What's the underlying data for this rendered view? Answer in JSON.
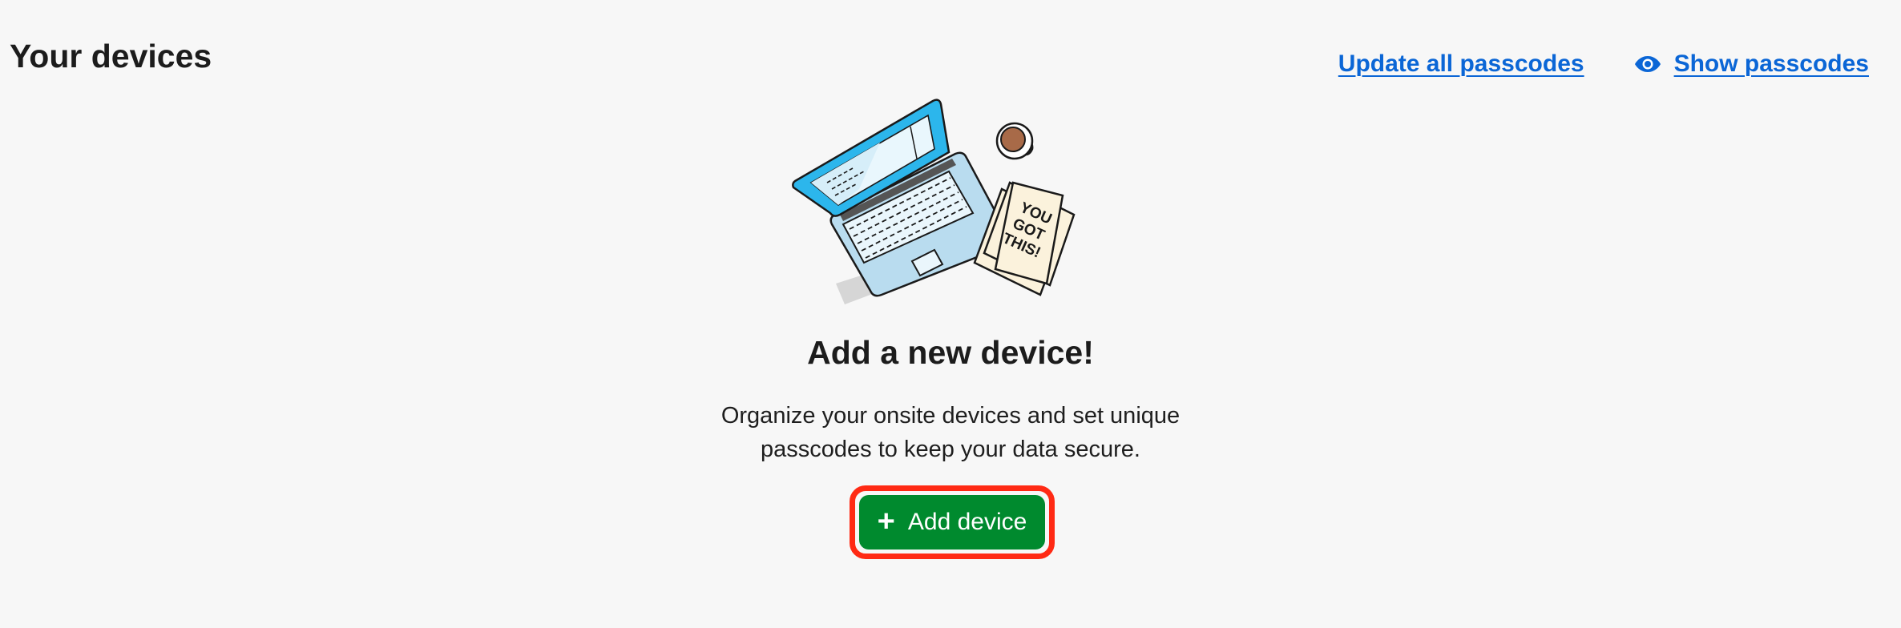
{
  "header": {
    "title": "Your devices",
    "update_all_label": "Update all passcodes",
    "show_passcodes_label": "Show passcodes",
    "eye_icon": "eye-icon"
  },
  "illustration": {
    "note_text": [
      "YOU",
      "GOT",
      "THIS!"
    ]
  },
  "empty_state": {
    "title": "Add a new device!",
    "description_lines": [
      "Organize your onsite devices and set unique",
      "passcodes to keep your data secure."
    ],
    "add_button_label": "Add device",
    "add_button_icon": "plus-icon"
  },
  "colors": {
    "link": "#0b66d6",
    "button": "#008a2e",
    "highlight": "#ff2a14",
    "background": "#f7f7f7"
  }
}
